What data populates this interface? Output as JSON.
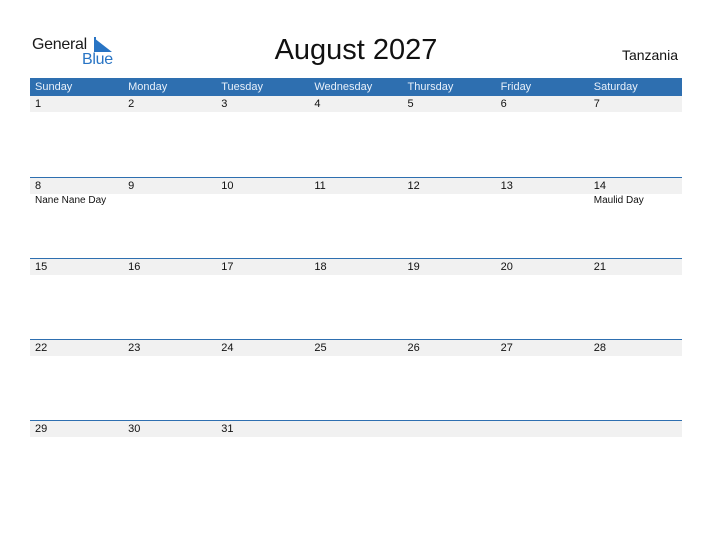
{
  "logo": {
    "line1": "General",
    "line2": "Blue",
    "accent_color": "#2874c4"
  },
  "header": {
    "title": "August 2027",
    "country": "Tanzania"
  },
  "calendar": {
    "header_color": "#2e6fb0",
    "weekdays": [
      "Sunday",
      "Monday",
      "Tuesday",
      "Wednesday",
      "Thursday",
      "Friday",
      "Saturday"
    ],
    "weeks": [
      {
        "dates": [
          "1",
          "2",
          "3",
          "4",
          "5",
          "6",
          "7"
        ],
        "events": [
          "",
          "",
          "",
          "",
          "",
          "",
          ""
        ]
      },
      {
        "dates": [
          "8",
          "9",
          "10",
          "11",
          "12",
          "13",
          "14"
        ],
        "events": [
          "Nane Nane Day",
          "",
          "",
          "",
          "",
          "",
          "Maulid Day"
        ]
      },
      {
        "dates": [
          "15",
          "16",
          "17",
          "18",
          "19",
          "20",
          "21"
        ],
        "events": [
          "",
          "",
          "",
          "",
          "",
          "",
          ""
        ]
      },
      {
        "dates": [
          "22",
          "23",
          "24",
          "25",
          "26",
          "27",
          "28"
        ],
        "events": [
          "",
          "",
          "",
          "",
          "",
          "",
          ""
        ]
      },
      {
        "dates": [
          "29",
          "30",
          "31",
          "",
          "",
          "",
          ""
        ],
        "events": [
          "",
          "",
          "",
          "",
          "",
          "",
          ""
        ]
      }
    ]
  }
}
